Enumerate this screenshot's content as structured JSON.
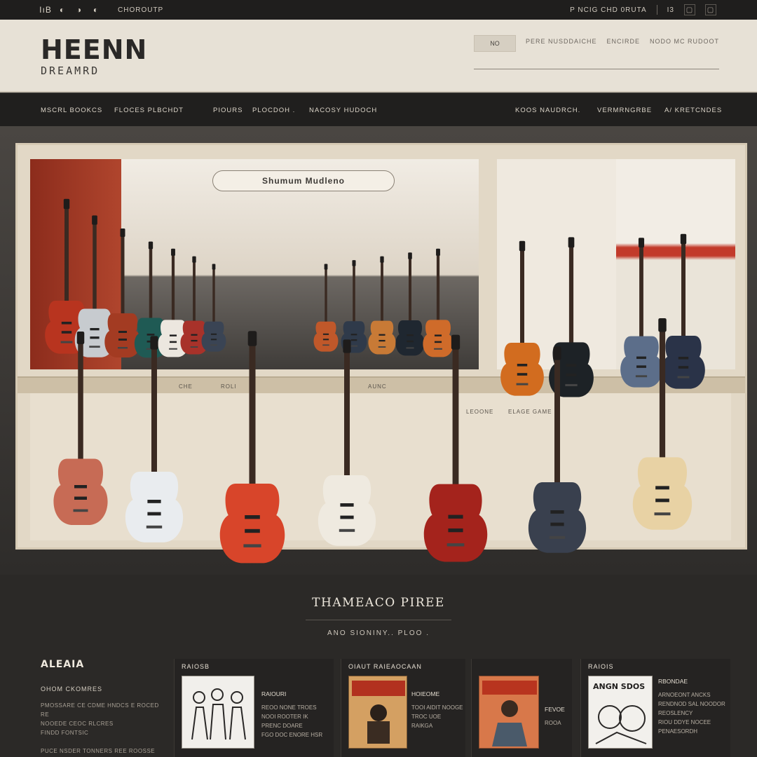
{
  "topbar": {
    "brand_glyphs": [
      "IıB",
      "◐",
      "◑",
      "◐"
    ],
    "left_text": "CHOROUTP",
    "right_text": "P NCIG CHD 0RUTA",
    "right_badge": "I3",
    "icons": [
      "square-icon",
      "square-icon"
    ]
  },
  "header": {
    "logo_main": "HEENN",
    "logo_sub": "DREAMRD",
    "search_button": "NO",
    "search_links": [
      "PERE NUSDDAICHE",
      "ENCIRDE",
      "NODO MC RUDOOT"
    ]
  },
  "nav": {
    "items": [
      "MSCRL BOOKCS",
      "FLOCES PLBCHDT",
      "PIOURS",
      "PLOCDOH .",
      "NACOSY HUDOCH",
      "KOOS NAUDRCH.",
      "VERMRNGRBE",
      "A/ KRETCNDES"
    ]
  },
  "hero": {
    "room_sign": "Shumum Mudleno",
    "shelf_labels": [
      "CHE",
      "ROLI",
      "AUNC",
      "LEOONE",
      "ELAGE GAME"
    ]
  },
  "featured": {
    "title": "THAMEACO PIREE",
    "subtitle": "ANO SIONINY.. PLOO  ."
  },
  "about": {
    "title": "ALEAIA",
    "subtitle": "OHOM CKOMRES",
    "lines": [
      "PMOSSARE CE CDME HNDCS E ROCED RE",
      "NOOEDE CEOC RLCRES",
      "FINDD FONTSIC",
      "PUCE NSDER TONNERS REE ROOSSE"
    ]
  },
  "cards": [
    {
      "title": "RAIOSB",
      "heading": "RAIOURI",
      "lines": [
        "REOO NONE TROES",
        "NOOI ROOTER IK",
        "PRENC DOARE",
        "FGO DOC ENORE HSR"
      ]
    },
    {
      "title": "OIAUT    RAIEAOCAAN",
      "heading": "HOIEOME",
      "lines": [
        "TOOI AIDIT NOOGE",
        "TROC UOE",
        "RAIKGA"
      ]
    },
    {
      "title": "",
      "heading": "FEVOE",
      "lines": [
        "ROOA"
      ]
    },
    {
      "title": "RAIOIS",
      "heading": "RBONDAE",
      "lines": [
        "ARNOEONT ANCKS",
        "RENDNOD SAL NOODOR",
        "REOSLENCY",
        "RIOU DDYE NOCEE",
        "PENAESORDH"
      ]
    }
  ],
  "colors": {
    "page_bg": "#2b2927",
    "header_bg": "#e7e1d6",
    "nav_bg": "#201f1e",
    "accent_red": "#c23a2a"
  }
}
